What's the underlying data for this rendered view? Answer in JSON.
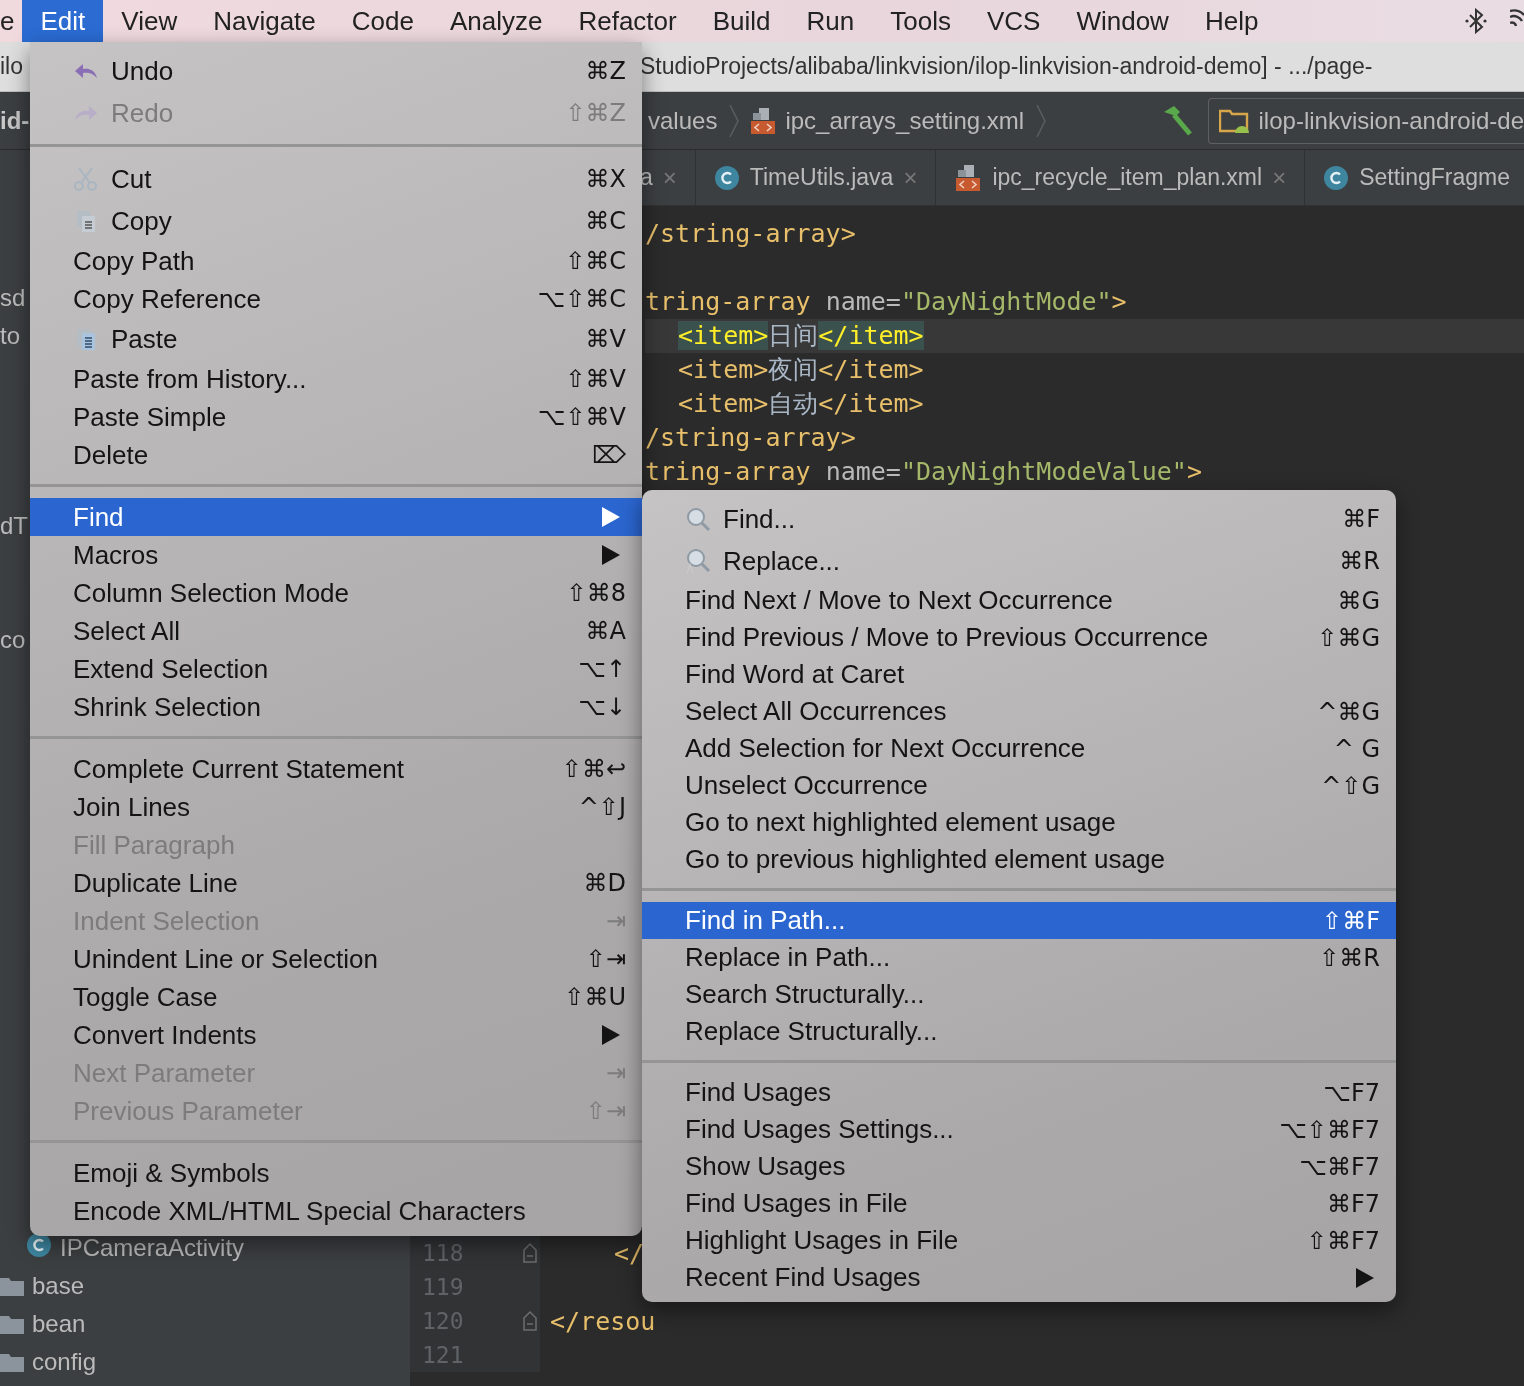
{
  "menu_bar": {
    "items": [
      {
        "label": "e",
        "selected": false
      },
      {
        "label": "Edit",
        "selected": true
      },
      {
        "label": "View",
        "selected": false
      },
      {
        "label": "Navigate",
        "selected": false
      },
      {
        "label": "Code",
        "selected": false
      },
      {
        "label": "Analyze",
        "selected": false
      },
      {
        "label": "Refactor",
        "selected": false
      },
      {
        "label": "Build",
        "selected": false
      },
      {
        "label": "Run",
        "selected": false
      },
      {
        "label": "Tools",
        "selected": false
      },
      {
        "label": "VCS",
        "selected": false
      },
      {
        "label": "Window",
        "selected": false
      },
      {
        "label": "Help",
        "selected": false
      }
    ]
  },
  "title_bar": {
    "left_text": "ilo",
    "title": "StudioProjects/alibaba/linkvision/ilop-linkvision-android-demo] - .../page-"
  },
  "nav_bar": {
    "left_text": "id-",
    "breadcrumbs": [
      "values",
      "ipc_arrays_setting.xml"
    ],
    "run_config": "ilop-linkvision-android-de"
  },
  "editor_tabs": [
    {
      "label": "a",
      "kind": "plain",
      "close": "×",
      "selected": false
    },
    {
      "label": "TimeUtils.java",
      "kind": "class",
      "close": "×",
      "selected": false
    },
    {
      "label": "ipc_recycle_item_plan.xml",
      "kind": "xml",
      "close": "×",
      "selected": false
    },
    {
      "label": "SettingFragme",
      "kind": "class",
      "selected": false
    }
  ],
  "project_tree": [
    {
      "label": "sd",
      "kind": "plain"
    },
    {
      "label": "to",
      "kind": "plain"
    },
    {
      "label": "dT",
      "kind": "plain"
    },
    {
      "label": "co",
      "kind": "plain"
    },
    {
      "label": "IPCameraActivity",
      "kind": "class"
    },
    {
      "label": "base",
      "kind": "folder"
    },
    {
      "label": "bean",
      "kind": "folder"
    },
    {
      "label": "config",
      "kind": "folder"
    }
  ],
  "code_top": [
    {
      "kind": "line",
      "current": false,
      "parts": [
        {
          "kind": "tag",
          "text": "/string-array>"
        }
      ]
    },
    {
      "kind": "blank",
      "current": false
    },
    {
      "kind": "line",
      "current": false,
      "parts": [
        {
          "kind": "tag",
          "text": "tring-array"
        },
        {
          "kind": "attr",
          "text": " name="
        },
        {
          "kind": "value",
          "text": "\"DayNightMode\""
        },
        {
          "kind": "tag",
          "text": ">"
        }
      ]
    },
    {
      "kind": "item",
      "current": true,
      "parts": [
        {
          "kind": "tag",
          "text": "<item>"
        },
        {
          "kind": "text",
          "text": "日间"
        },
        {
          "kind": "tag",
          "text": "</item>"
        }
      ]
    },
    {
      "kind": "item",
      "current": false,
      "parts": [
        {
          "kind": "tag",
          "text": "<item>"
        },
        {
          "kind": "text",
          "text": "夜间"
        },
        {
          "kind": "tag",
          "text": "</item>"
        }
      ]
    },
    {
      "kind": "item",
      "current": false,
      "parts": [
        {
          "kind": "tag",
          "text": "<item>"
        },
        {
          "kind": "text",
          "text": "自动"
        },
        {
          "kind": "tag",
          "text": "</item>"
        }
      ]
    },
    {
      "kind": "line",
      "current": false,
      "parts": [
        {
          "kind": "tag",
          "text": "/string-array>"
        }
      ]
    },
    {
      "kind": "line",
      "current": false,
      "parts": [
        {
          "kind": "tag",
          "text": "tring-array"
        },
        {
          "kind": "attr",
          "text": " name="
        },
        {
          "kind": "value",
          "text": "\"DayNightModeValue\""
        },
        {
          "kind": "tag",
          "text": ">"
        }
      ]
    }
  ],
  "code_bottom": [
    {
      "number": "118",
      "fold": true,
      "kind": "item",
      "text": "</"
    },
    {
      "number": "119",
      "fold": false,
      "kind": "blank"
    },
    {
      "number": "120",
      "fold": true,
      "kind": "line",
      "text": "</resou"
    },
    {
      "number": "121",
      "fold": false,
      "kind": "blank"
    }
  ],
  "edit_menu": {
    "groups": [
      {
        "items": [
          {
            "label": "Undo",
            "shortcut": "⌘Z",
            "kind": "undo",
            "disabled": false,
            "selected": false,
            "submenu": false
          },
          {
            "label": "Redo",
            "shortcut": "⇧⌘Z",
            "kind": "redo",
            "disabled": true,
            "selected": false,
            "submenu": false
          }
        ]
      },
      {
        "items": [
          {
            "label": "Cut",
            "shortcut": "⌘X",
            "kind": "cut",
            "disabled": false,
            "selected": false,
            "submenu": false
          },
          {
            "label": "Copy",
            "shortcut": "⌘C",
            "kind": "copy",
            "disabled": false,
            "selected": false,
            "submenu": false
          },
          {
            "label": "Copy Path",
            "shortcut": "⇧⌘C",
            "kind": "plain",
            "disabled": false,
            "selected": false,
            "submenu": false
          },
          {
            "label": "Copy Reference",
            "shortcut": "⌥⇧⌘C",
            "kind": "plain",
            "disabled": false,
            "selected": false,
            "submenu": false
          },
          {
            "label": "Paste",
            "shortcut": "⌘V",
            "kind": "paste",
            "disabled": false,
            "selected": false,
            "submenu": false
          },
          {
            "label": "Paste from History...",
            "shortcut": "⇧⌘V",
            "kind": "plain",
            "disabled": false,
            "selected": false,
            "submenu": false
          },
          {
            "label": "Paste Simple",
            "shortcut": "⌥⇧⌘V",
            "kind": "plain",
            "disabled": false,
            "selected": false,
            "submenu": false
          },
          {
            "label": "Delete",
            "shortcut": "⌦",
            "kind": "plain",
            "disabled": false,
            "selected": false,
            "submenu": false
          }
        ]
      },
      {
        "items": [
          {
            "label": "Find",
            "kind": "plain",
            "disabled": false,
            "selected": true,
            "submenu": true
          },
          {
            "label": "Macros",
            "kind": "plain",
            "disabled": false,
            "selected": false,
            "submenu": true
          },
          {
            "label": "Column Selection Mode",
            "shortcut": "⇧⌘8",
            "kind": "plain",
            "disabled": false,
            "selected": false,
            "submenu": false
          },
          {
            "label": "Select All",
            "shortcut": "⌘A",
            "kind": "plain",
            "disabled": false,
            "selected": false,
            "submenu": false
          },
          {
            "label": "Extend Selection",
            "shortcut": "⌥↑",
            "kind": "plain",
            "disabled": false,
            "selected": false,
            "submenu": false
          },
          {
            "label": "Shrink Selection",
            "shortcut": "⌥↓",
            "kind": "plain",
            "disabled": false,
            "selected": false,
            "submenu": false
          }
        ]
      },
      {
        "items": [
          {
            "label": "Complete Current Statement",
            "shortcut": "⇧⌘↩",
            "kind": "plain",
            "disabled": false,
            "selected": false,
            "submenu": false
          },
          {
            "label": "Join Lines",
            "shortcut": "^⇧J",
            "kind": "plain",
            "disabled": false,
            "selected": false,
            "submenu": false
          },
          {
            "label": "Fill Paragraph",
            "kind": "plain",
            "disabled": true,
            "selected": false,
            "submenu": false
          },
          {
            "label": "Duplicate Line",
            "shortcut": "⌘D",
            "kind": "plain",
            "disabled": false,
            "selected": false,
            "submenu": false
          },
          {
            "label": "Indent Selection",
            "shortcut": "⇥",
            "kind": "plain",
            "disabled": true,
            "selected": false,
            "submenu": false
          },
          {
            "label": "Unindent Line or Selection",
            "shortcut": "⇧⇥",
            "kind": "plain",
            "disabled": false,
            "selected": false,
            "submenu": false
          },
          {
            "label": "Toggle Case",
            "shortcut": "⇧⌘U",
            "kind": "plain",
            "disabled": false,
            "selected": false,
            "submenu": false
          },
          {
            "label": "Convert Indents",
            "kind": "plain",
            "disabled": false,
            "selected": false,
            "submenu": true
          },
          {
            "label": "Next Parameter",
            "shortcut": "⇥",
            "kind": "plain",
            "disabled": true,
            "selected": false,
            "submenu": false
          },
          {
            "label": "Previous Parameter",
            "shortcut": "⇧⇥",
            "kind": "plain",
            "disabled": true,
            "selected": false,
            "submenu": false
          }
        ]
      },
      {
        "items": [
          {
            "label": "Emoji & Symbols",
            "kind": "plain",
            "disabled": false,
            "selected": false,
            "submenu": false
          },
          {
            "label": "Encode XML/HTML Special Characters",
            "kind": "plain",
            "disabled": false,
            "selected": false,
            "submenu": false
          }
        ]
      }
    ]
  },
  "find_submenu": {
    "groups": [
      {
        "items": [
          {
            "label": "Find...",
            "shortcut": "⌘F",
            "kind": "find",
            "disabled": false,
            "selected": false,
            "submenu": false
          },
          {
            "label": "Replace...",
            "shortcut": "⌘R",
            "kind": "replace",
            "disabled": false,
            "selected": false,
            "submenu": false
          },
          {
            "label": "Find Next / Move to Next Occurrence",
            "shortcut": "⌘G",
            "kind": "plain",
            "disabled": false,
            "selected": false,
            "submenu": false
          },
          {
            "label": "Find Previous / Move to Previous Occurrence",
            "shortcut": "⇧⌘G",
            "kind": "plain",
            "disabled": false,
            "selected": false,
            "submenu": false
          },
          {
            "label": "Find Word at Caret",
            "kind": "plain",
            "disabled": false,
            "selected": false,
            "submenu": false
          },
          {
            "label": "Select All Occurrences",
            "shortcut": "^⌘G",
            "kind": "plain",
            "disabled": false,
            "selected": false,
            "submenu": false
          },
          {
            "label": "Add Selection for Next Occurrence",
            "shortcut": "^ G",
            "kind": "plain",
            "disabled": false,
            "selected": false,
            "submenu": false
          },
          {
            "label": "Unselect Occurrence",
            "shortcut": "^⇧G",
            "kind": "plain",
            "disabled": false,
            "selected": false,
            "submenu": false
          },
          {
            "label": "Go to next highlighted element usage",
            "kind": "plain",
            "disabled": false,
            "selected": false,
            "submenu": false
          },
          {
            "label": "Go to previous highlighted element usage",
            "kind": "plain",
            "disabled": false,
            "selected": false,
            "submenu": false
          }
        ]
      },
      {
        "items": [
          {
            "label": "Find in Path...",
            "shortcut": "⇧⌘F",
            "kind": "plain",
            "disabled": false,
            "selected": true,
            "submenu": false
          },
          {
            "label": "Replace in Path...",
            "shortcut": "⇧⌘R",
            "kind": "plain",
            "disabled": false,
            "selected": false,
            "submenu": false
          },
          {
            "label": "Search Structurally...",
            "kind": "plain",
            "disabled": false,
            "selected": false,
            "submenu": false
          },
          {
            "label": "Replace Structurally...",
            "kind": "plain",
            "disabled": false,
            "selected": false,
            "submenu": false
          }
        ]
      },
      {
        "items": [
          {
            "label": "Find Usages",
            "shortcut": "⌥F7",
            "kind": "plain",
            "disabled": false,
            "selected": false,
            "submenu": false
          },
          {
            "label": "Find Usages Settings...",
            "shortcut": "⌥⇧⌘F7",
            "kind": "plain",
            "disabled": false,
            "selected": false,
            "submenu": false
          },
          {
            "label": "Show Usages",
            "shortcut": "⌥⌘F7",
            "kind": "plain",
            "disabled": false,
            "selected": false,
            "submenu": false
          },
          {
            "label": "Find Usages in File",
            "shortcut": "⌘F7",
            "kind": "plain",
            "disabled": false,
            "selected": false,
            "submenu": false
          },
          {
            "label": "Highlight Usages in File",
            "shortcut": "⇧⌘F7",
            "kind": "plain",
            "disabled": false,
            "selected": false,
            "submenu": false
          },
          {
            "label": "Recent Find Usages",
            "kind": "plain",
            "disabled": false,
            "selected": false,
            "submenu": true
          }
        ]
      }
    ]
  }
}
